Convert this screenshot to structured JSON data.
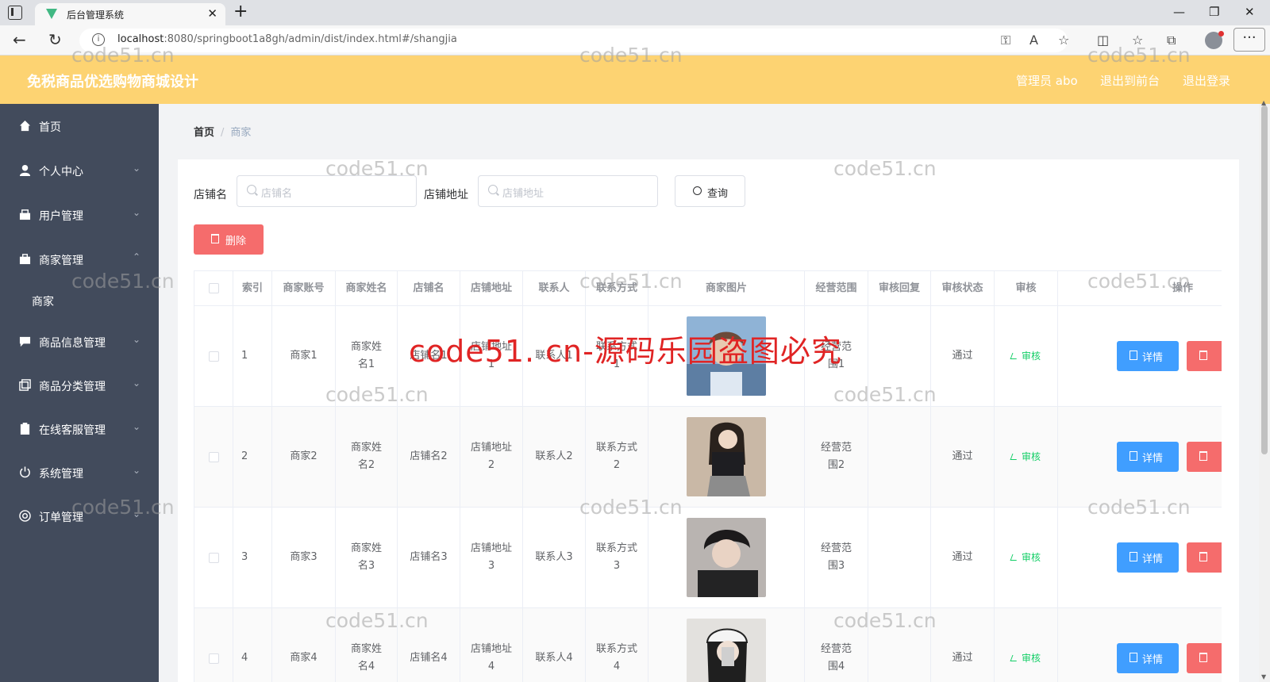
{
  "browser": {
    "tab_title": "后台管理系统",
    "url_host": "localhost",
    "url_rest": ":8080/springboot1a8gh/admin/dist/index.html#/shangjia"
  },
  "header": {
    "title": "免税商品优选购物商城设计",
    "admin": "管理员 abo",
    "goto_front": "退出到前台",
    "logout": "退出登录",
    "bg_color": "#fdd372"
  },
  "sidebar": {
    "items": [
      {
        "label": "首页",
        "icon": "home-icon"
      },
      {
        "label": "个人中心",
        "icon": "user-icon"
      },
      {
        "label": "用户管理",
        "icon": "users-icon"
      },
      {
        "label": "商家管理",
        "icon": "briefcase-icon",
        "expanded": true,
        "children": [
          "商家"
        ]
      },
      {
        "label": "商品信息管理",
        "icon": "chat-icon"
      },
      {
        "label": "商品分类管理",
        "icon": "copy-icon"
      },
      {
        "label": "在线客服管理",
        "icon": "clipboard-icon"
      },
      {
        "label": "系统管理",
        "icon": "power-icon"
      },
      {
        "label": "订单管理",
        "icon": "orders-icon"
      }
    ]
  },
  "breadcrumb": {
    "home": "首页",
    "current": "商家"
  },
  "search": {
    "shop_label": "店铺名",
    "shop_placeholder": "店铺名",
    "addr_label": "店铺地址",
    "addr_placeholder": "店铺地址",
    "query_btn": "查询"
  },
  "toolbar": {
    "delete_btn": "删除"
  },
  "table": {
    "headers": [
      "索引",
      "商家账号",
      "商家姓名",
      "店铺名",
      "店铺地址",
      "联系人",
      "联系方式",
      "商家图片",
      "经营范围",
      "审核回复",
      "审核状态",
      "审核",
      "操作"
    ],
    "rows": [
      {
        "index": "1",
        "account": "商家1",
        "name": "商家姓名1",
        "shop": "店铺名1",
        "addr": "店铺地址1",
        "contact": "联系人1",
        "phone": "联系方式1",
        "scope": "经营范围1",
        "reply": "",
        "status": "通过",
        "audit": "审核",
        "detail": "详情"
      },
      {
        "index": "2",
        "account": "商家2",
        "name": "商家姓名2",
        "shop": "店铺名2",
        "addr": "店铺地址2",
        "contact": "联系人2",
        "phone": "联系方式2",
        "scope": "经营范围2",
        "reply": "",
        "status": "通过",
        "audit": "审核",
        "detail": "详情"
      },
      {
        "index": "3",
        "account": "商家3",
        "name": "商家姓名3",
        "shop": "店铺名3",
        "addr": "店铺地址3",
        "contact": "联系人3",
        "phone": "联系方式3",
        "scope": "经营范围3",
        "reply": "",
        "status": "通过",
        "audit": "审核",
        "detail": "详情"
      },
      {
        "index": "4",
        "account": "商家4",
        "name": "商家姓名4",
        "shop": "店铺名4",
        "addr": "店铺地址4",
        "contact": "联系人4",
        "phone": "联系方式4",
        "scope": "经营范围4",
        "reply": "",
        "status": "通过",
        "audit": "审核",
        "detail": "详情"
      }
    ]
  },
  "watermark": {
    "small": "code51.cn",
    "big": "code51. cn-源码乐园盗图必究"
  },
  "colors": {
    "sidebar_bg": "#424b5c",
    "primary": "#409eff",
    "danger": "#f56c6c",
    "success": "#13ce66"
  }
}
